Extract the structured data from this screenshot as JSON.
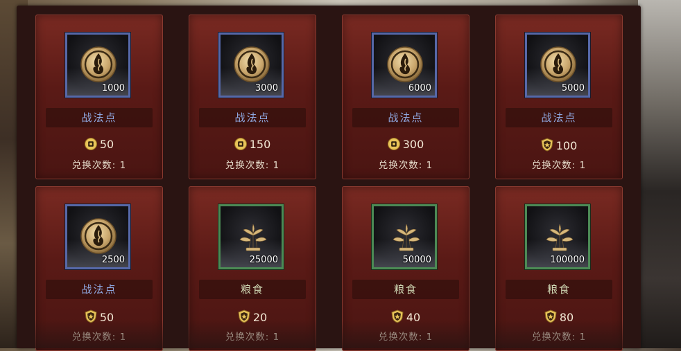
{
  "items": [
    {
      "icon": "tactic-point-icon",
      "frame": "blue",
      "amount": "1000",
      "name": "战法点",
      "currency": "coin-icon",
      "price": "50",
      "limit_label": "兑换次数: 1"
    },
    {
      "icon": "tactic-point-icon",
      "frame": "blue",
      "amount": "3000",
      "name": "战法点",
      "currency": "coin-icon",
      "price": "150",
      "limit_label": "兑换次数: 1"
    },
    {
      "icon": "tactic-point-icon",
      "frame": "blue",
      "amount": "6000",
      "name": "战法点",
      "currency": "coin-icon",
      "price": "300",
      "limit_label": "兑换次数: 1"
    },
    {
      "icon": "tactic-point-icon",
      "frame": "blue",
      "amount": "5000",
      "name": "战法点",
      "currency": "shield-token-icon",
      "price": "100",
      "limit_label": "兑换次数: 1"
    },
    {
      "icon": "tactic-point-icon",
      "frame": "blue",
      "amount": "2500",
      "name": "战法点",
      "currency": "shield-token-icon",
      "price": "50",
      "limit_label": "兑换次数: 1"
    },
    {
      "icon": "grain-icon",
      "frame": "green",
      "amount": "25000",
      "name": "粮食",
      "currency": "shield-token-icon",
      "price": "20",
      "limit_label": "兑换次数: 1"
    },
    {
      "icon": "grain-icon",
      "frame": "green",
      "amount": "50000",
      "name": "粮食",
      "currency": "shield-token-icon",
      "price": "40",
      "limit_label": "兑换次数: 1"
    },
    {
      "icon": "grain-icon",
      "frame": "green",
      "amount": "100000",
      "name": "粮食",
      "currency": "shield-token-icon",
      "price": "80",
      "limit_label": "兑换次数: 1"
    }
  ],
  "colors": {
    "card_bg": "#5a1a16",
    "frame_blue": "#5668a8",
    "frame_green": "#4c8a55",
    "name_blue": "#8fa8e0",
    "name_green": "#cfd8b4",
    "gold": "#e8c45a"
  }
}
